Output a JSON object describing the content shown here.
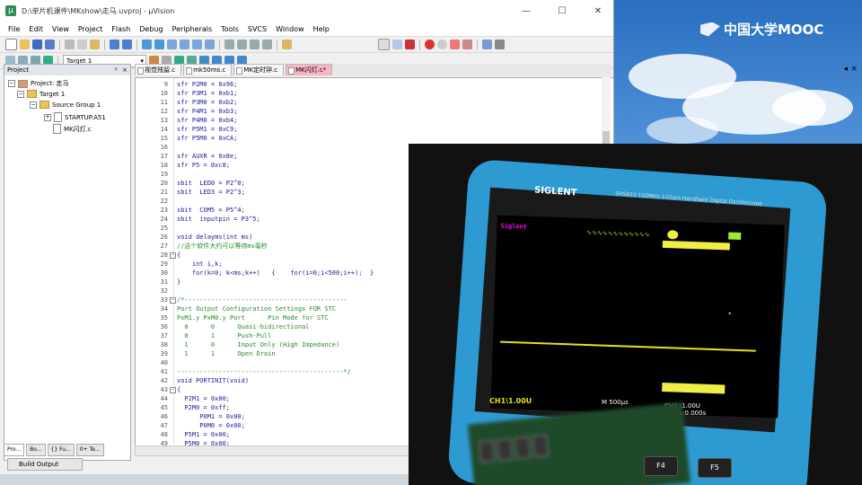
{
  "window": {
    "title": "D:\\单片机课件\\MKshow\\走马.uvproj - µVision",
    "minimize": "—",
    "maximize": "☐",
    "close": "✕"
  },
  "menu": [
    "File",
    "Edit",
    "View",
    "Project",
    "Flash",
    "Debug",
    "Peripherals",
    "Tools",
    "SVCS",
    "Window",
    "Help"
  ],
  "toolbar": {
    "target": "Target 1"
  },
  "project_panel": {
    "header": "Project",
    "tree": [
      {
        "label": "Project: 走马"
      },
      {
        "label": "Target 1"
      },
      {
        "label": "Source Group 1"
      },
      {
        "label": "STARTUP.A51"
      },
      {
        "label": "MK闪灯.c"
      }
    ],
    "tabs": [
      "Pro...",
      "Bo...",
      "{} Fu...",
      "0+ Te..."
    ]
  },
  "editor_tabs": [
    "视觉残留.c",
    "mk50ms.c",
    "MK定时钟.c",
    "MK闪灯.c*"
  ],
  "code_lines": [
    {
      "n": "9",
      "t": "sfr P2M0 = 0x96;"
    },
    {
      "n": "10",
      "t": "sfr P3M1 = 0xb1;"
    },
    {
      "n": "11",
      "t": "sfr P3M0 = 0xb2;"
    },
    {
      "n": "12",
      "t": "sfr P4M1 = 0xb3;"
    },
    {
      "n": "13",
      "t": "sfr P4M0 = 0xb4;"
    },
    {
      "n": "14",
      "t": "sfr P5M1 = 0xC9;"
    },
    {
      "n": "15",
      "t": "sfr P5M0 = 0xCA;"
    },
    {
      "n": "16",
      "t": ""
    },
    {
      "n": "17",
      "t": "sfr AUXR = 0x8e;"
    },
    {
      "n": "18",
      "t": "sfr P5 = 0xc8;"
    },
    {
      "n": "19",
      "t": ""
    },
    {
      "n": "20",
      "t": "sbit  LED0 = P2^0;"
    },
    {
      "n": "21",
      "t": "sbit  LED3 = P2^3;"
    },
    {
      "n": "22",
      "t": ""
    },
    {
      "n": "23",
      "t": "sbit  COM5 = P5^4;"
    },
    {
      "n": "24",
      "t": "sbit  inputpin = P3^5;"
    },
    {
      "n": "25",
      "t": ""
    },
    {
      "n": "26",
      "t": "void delayms(int ms)"
    },
    {
      "n": "27",
      "t": "//这个软件大约可以等待ms毫秒",
      "c": true
    },
    {
      "n": "28",
      "t": "{",
      "f": true
    },
    {
      "n": "29",
      "t": "    int i,k;"
    },
    {
      "n": "30",
      "t": "    for(k=0; k<ms;k++)   {    for(i=0;i<500;i++);  }"
    },
    {
      "n": "31",
      "t": "}"
    },
    {
      "n": "32",
      "t": ""
    },
    {
      "n": "33",
      "t": "/*-------------------------------------------",
      "c": true,
      "f": true
    },
    {
      "n": "34",
      "t": "Port Output Configuration Settings FOR STC",
      "c": true
    },
    {
      "n": "35",
      "t": "PxM1.y PxM0.y Port      Pin Mode for STC",
      "c": true
    },
    {
      "n": "36",
      "t": "  0      0      Quasi-bidirectional",
      "c": true
    },
    {
      "n": "37",
      "t": "  0      1      Push-Pull",
      "c": true
    },
    {
      "n": "38",
      "t": "  1      0      Input Only (High Impedance)",
      "c": true
    },
    {
      "n": "39",
      "t": "  1      1      Open Drain",
      "c": true
    },
    {
      "n": "40",
      "t": "",
      "c": true
    },
    {
      "n": "41",
      "t": "--------------------------------------------*/",
      "c": true
    },
    {
      "n": "42",
      "t": "void PORTINIT(void)"
    },
    {
      "n": "43",
      "t": "{",
      "f": true
    },
    {
      "n": "44",
      "t": "  P2M1 = 0x00;"
    },
    {
      "n": "45",
      "t": "  P2M0 = 0xff;"
    },
    {
      "n": "46",
      "t": "      P0M1 = 0x00;"
    },
    {
      "n": "47",
      "t": "      P0M0 = 0x00;"
    },
    {
      "n": "48",
      "t": "  P5M1 = 0x00;"
    },
    {
      "n": "49",
      "t": "  P5M0 = 0x00;"
    }
  ],
  "build_output_tab": "Build Output",
  "watermark": "中国大学MOOC",
  "scope": {
    "brand": "SIGLENT",
    "model": "SHS810  100MHz 1GSa/s  Handheld Digital Oscilloscope",
    "logo_text": "Siglent",
    "ch1_scale": "CH1\\1.00U",
    "time_scale": "M 500μs",
    "ch1_right": "CH1 \\1.00U",
    "pos": "M Pos:0.000s",
    "f4": "F4",
    "f5": "F5"
  }
}
